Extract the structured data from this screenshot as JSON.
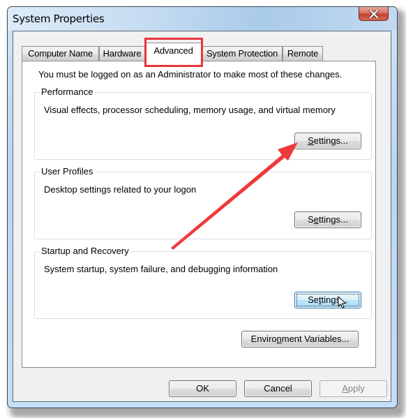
{
  "window": {
    "title": "System Properties",
    "close_icon": "close-icon"
  },
  "tabs": [
    {
      "label": "Computer Name",
      "active": false
    },
    {
      "label": "Hardware",
      "active": false
    },
    {
      "label": "Advanced",
      "active": true
    },
    {
      "label": "System Protection",
      "active": false
    },
    {
      "label": "Remote",
      "active": false
    }
  ],
  "advanced": {
    "admin_note": "You must be logged on as an Administrator to make most of these changes.",
    "groups": [
      {
        "label": "Performance",
        "description": "Visual effects, processor scheduling, memory usage, and virtual memory",
        "button": {
          "pre": "",
          "accel": "S",
          "post": "ettings..."
        }
      },
      {
        "label": "User Profiles",
        "description": "Desktop settings related to your logon",
        "button": {
          "pre": "S",
          "accel": "e",
          "post": "ttings..."
        }
      },
      {
        "label": "Startup and Recovery",
        "description": "System startup, system failure, and debugging information",
        "button": {
          "pre": "Se",
          "accel": "t",
          "post": "tings..."
        }
      }
    ],
    "env_button": {
      "pre": "Enviro",
      "accel": "n",
      "post": "ment Variables..."
    }
  },
  "footer": {
    "ok": "OK",
    "cancel": "Cancel",
    "apply": {
      "pre": "",
      "accel": "A",
      "post": "pply"
    }
  },
  "annotations": {
    "highlight_color": "#e8353a",
    "arrow_color": "#f03a3a"
  }
}
